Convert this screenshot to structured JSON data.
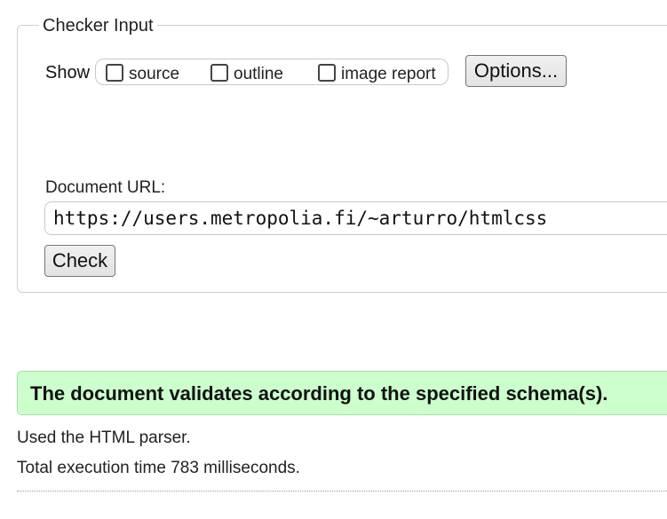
{
  "checker_input": {
    "legend": "Checker Input",
    "show_label": "Show",
    "checkboxes": [
      {
        "label": "source",
        "checked": false
      },
      {
        "label": "outline",
        "checked": false
      },
      {
        "label": "image report",
        "checked": false
      }
    ],
    "options_button": "Options...",
    "url_label": "Document URL:",
    "url_value": "https://users.metropolia.fi/~arturro/htmlcss",
    "check_button": "Check"
  },
  "result": {
    "success_message": "The document validates according to the specified schema(s).",
    "parser_info": "Used the HTML parser.",
    "execution_time": "Total execution time 783 milliseconds."
  },
  "colors": {
    "success_background": "#ccffcc",
    "success_border": "#a8dca8"
  }
}
